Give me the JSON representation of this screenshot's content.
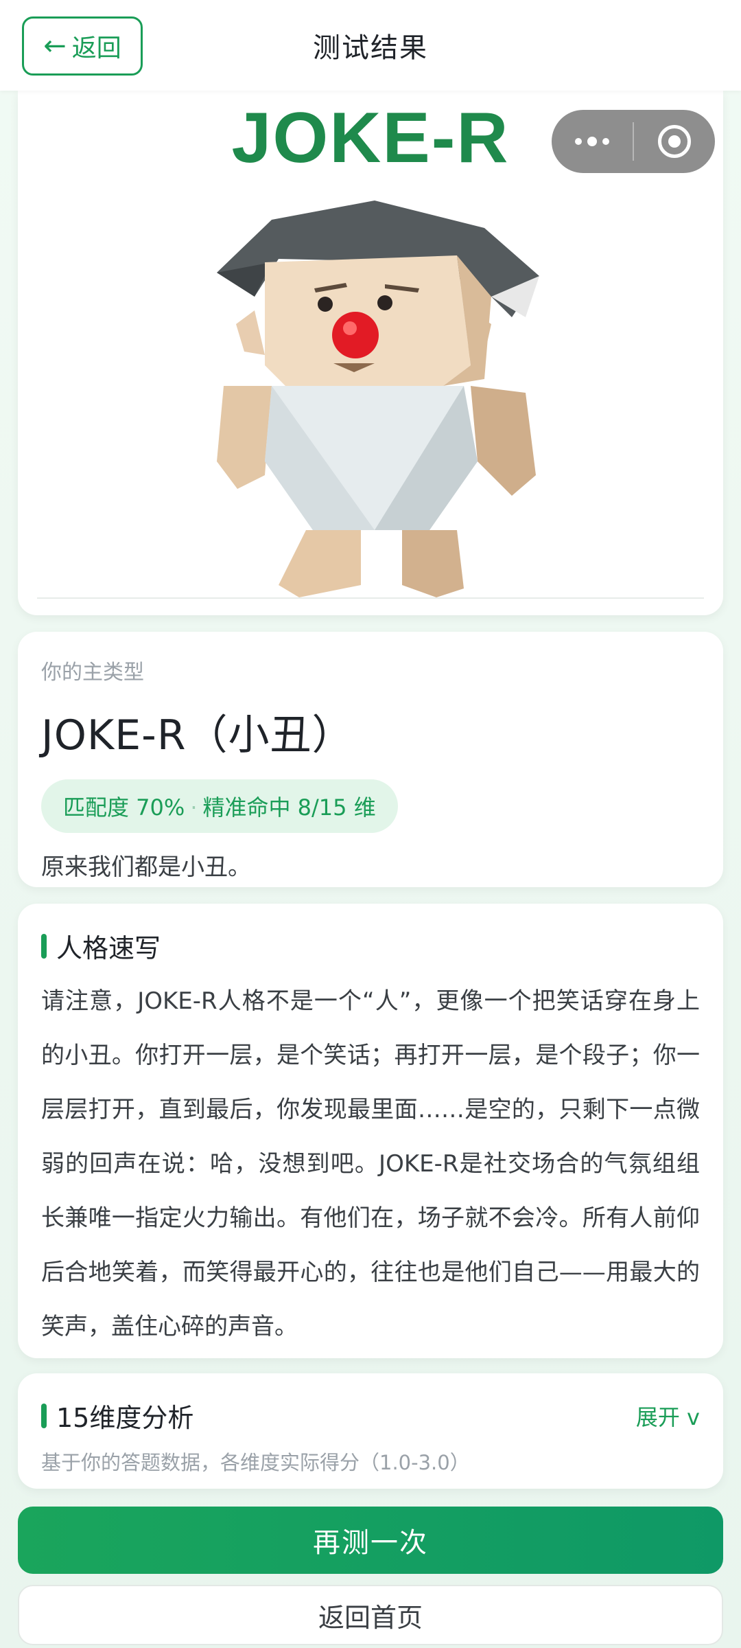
{
  "header": {
    "back_label": "返回",
    "title": "测试结果"
  },
  "hero": {
    "image_text": "JOKE-R",
    "image_subject": "voxel clown character with red nose and white bib"
  },
  "mini_program_capsule": {
    "more_icon": "ellipsis-icon",
    "close_icon": "target-icon"
  },
  "result": {
    "type_label": "你的主类型",
    "type_name": "JOKE-R（小丑）",
    "match_text": "匹配度 70%",
    "hit_text": "精准命中 8/15 维",
    "tagline": "原来我们都是小丑。"
  },
  "sketch": {
    "title": "人格速写",
    "body": "请注意，JOKE-R人格不是一个“人”，更像一个把笑话穿在身上的小丑。你打开一层，是个笑话；再打开一层，是个段子；你一层层打开，直到最后，你发现最里面……是空的，只剩下一点微弱的回声在说：哈，没想到吧。JOKE-R是社交场合的气氛组组长兼唯一指定火力输出。有他们在，场子就不会冷。所有人前仰后合地笑着，而笑得最开心的，往往也是他们自己——用最大的笑声，盖住心碎的声音。"
  },
  "dimensions": {
    "title": "15维度分析",
    "expand_label": "展开 v",
    "subtitle": "基于你的答题数据，各维度实际得分（1.0-3.0）"
  },
  "actions": {
    "retry_label": "再测一次",
    "home_label": "返回首页"
  },
  "colors": {
    "accent": "#1a9d57",
    "pill_bg": "#e2f5e9"
  }
}
